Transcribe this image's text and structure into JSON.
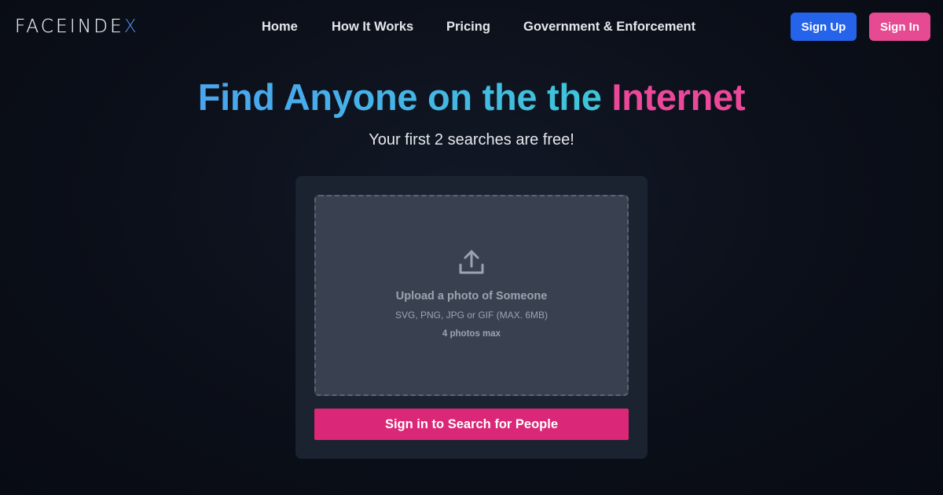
{
  "header": {
    "logo": {
      "main": "FACEINDE",
      "accent": "X"
    },
    "nav": [
      {
        "label": "Home"
      },
      {
        "label": "How It Works"
      },
      {
        "label": "Pricing"
      },
      {
        "label": "Government & Enforcement"
      }
    ],
    "sign_up_label": "Sign Up",
    "sign_in_label": "Sign In"
  },
  "hero": {
    "title_gradient": "Find Anyone on the the",
    "title_highlight": "Internet",
    "subtitle": "Your first 2 searches are free!"
  },
  "upload": {
    "icon": "upload-icon",
    "title": "Upload a photo of Someone",
    "formats": "SVG, PNG, JPG or GIF (MAX. 6MB)",
    "limit": "4 photos max"
  },
  "search_button_label": "Sign in to Search for People",
  "colors": {
    "background": "#0b0f19",
    "accent_blue": "#2563eb",
    "accent_pink": "#ec4899",
    "button_pink": "#db2777",
    "card": "#1b2230",
    "dropzone": "#394150"
  }
}
